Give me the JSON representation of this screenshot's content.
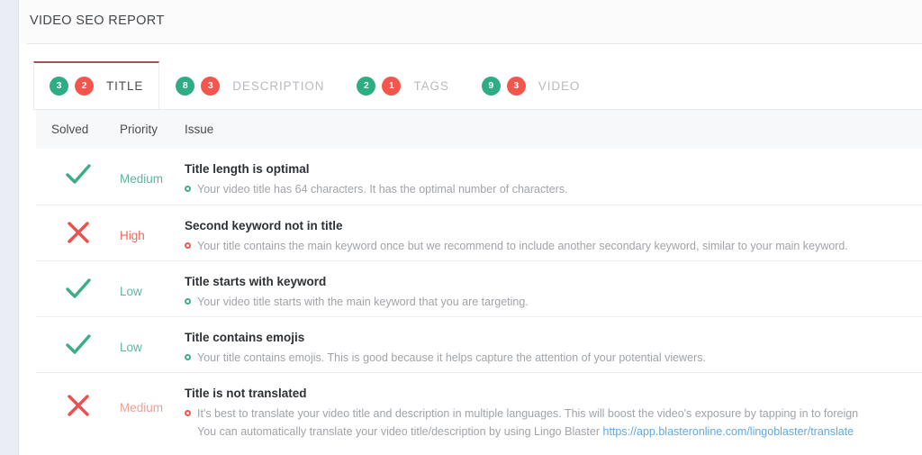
{
  "header": {
    "title": "VIDEO SEO REPORT"
  },
  "tabs": [
    {
      "green": "3",
      "red": "2",
      "label": "TITLE",
      "active": true
    },
    {
      "green": "8",
      "red": "3",
      "label": "DESCRIPTION",
      "active": false
    },
    {
      "green": "2",
      "red": "1",
      "label": "TAGS",
      "active": false
    },
    {
      "green": "9",
      "red": "3",
      "label": "VIDEO",
      "active": false
    }
  ],
  "table": {
    "columns": {
      "solved": "Solved",
      "priority": "Priority",
      "issue": "Issue"
    },
    "rows": [
      {
        "solved": "check",
        "priority": "Medium",
        "priority_state": "ok",
        "title": "Title length is optimal",
        "bullet": "green",
        "description": "Your video title has 64 characters. It has the optimal number of characters.",
        "description_line2": "",
        "link_text": ""
      },
      {
        "solved": "cross",
        "priority": "High",
        "priority_state": "high",
        "title": "Second keyword not in title",
        "bullet": "red",
        "description": "Your title contains the main keyword once but we recommend to include another secondary keyword, similar to your main keyword.",
        "description_line2": "",
        "link_text": ""
      },
      {
        "solved": "check",
        "priority": "Low",
        "priority_state": "ok",
        "title": "Title starts with keyword",
        "bullet": "green",
        "description": "Your video title starts with the main keyword that you are targeting.",
        "description_line2": "",
        "link_text": ""
      },
      {
        "solved": "check",
        "priority": "Low",
        "priority_state": "ok",
        "title": "Title contains emojis",
        "bullet": "green",
        "description": "Your title contains emojis. This is good because it helps capture the attention of your potential viewers.",
        "description_line2": "",
        "link_text": ""
      },
      {
        "solved": "cross",
        "priority": "Medium",
        "priority_state": "med",
        "title": "Title is not translated",
        "bullet": "red",
        "description": "It's best to translate your video title and description in multiple languages. This will boost the video's exposure by tapping in to foreign",
        "description_line2": "You can automatically translate your video title/description by using Lingo Blaster ",
        "link_text": "https://app.blasteronline.com/lingoblaster/translate"
      }
    ]
  },
  "colors": {
    "badge_green": "#2eac82",
    "badge_red": "#f4554c",
    "active_tab_border": "#a3505c",
    "check_green": "#3bae83",
    "cross_red": "#ee4e4e",
    "link_blue": "#62a8e0"
  }
}
